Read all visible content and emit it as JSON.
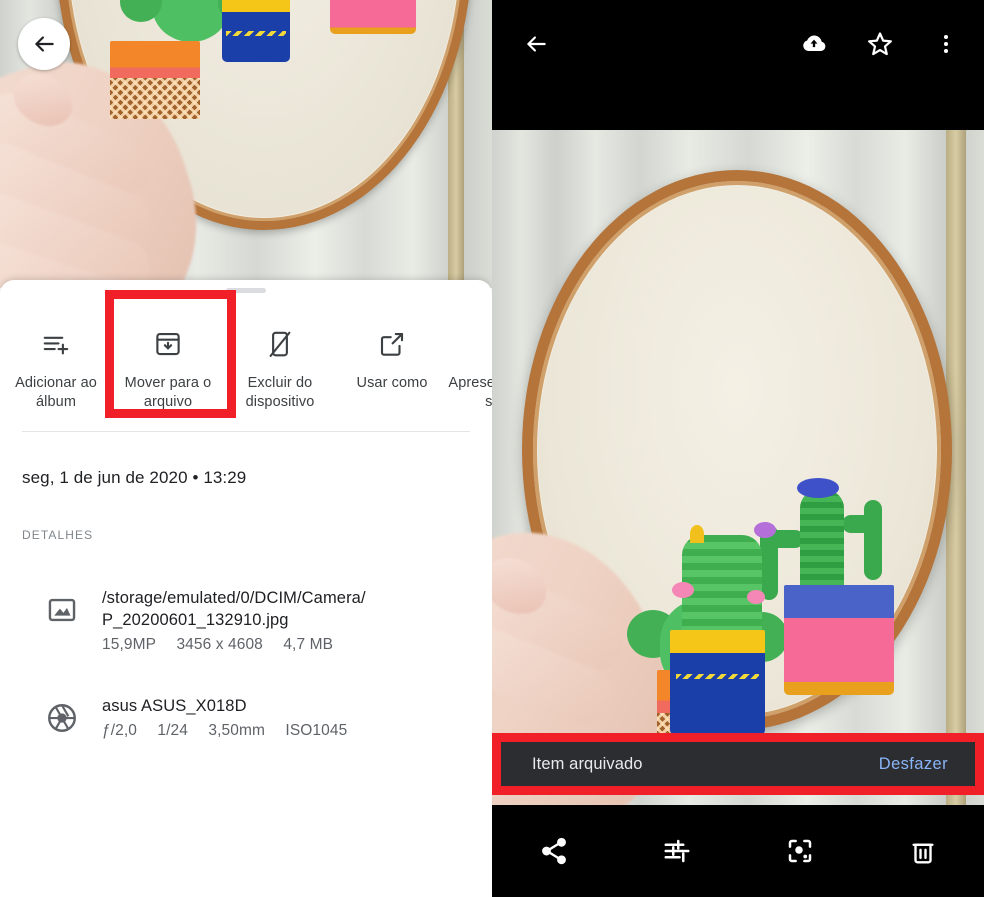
{
  "left_panel": {
    "photo": {
      "alt": "embroidery-hoop-cacti-photo-top",
      "back_icon": "back-arrow-icon"
    },
    "sheet": {
      "actions": [
        {
          "icon": "add-to-album-icon",
          "label": "Adicionar ao álbum",
          "highlighted": false
        },
        {
          "icon": "archive-icon",
          "label": "Mover para o arquivo",
          "highlighted": true
        },
        {
          "icon": "delete-from-device-icon",
          "label": "Excluir do dispositivo",
          "highlighted": false
        },
        {
          "icon": "open-external-icon",
          "label": "Usar como",
          "highlighted": false
        },
        {
          "icon": "slideshow-icon",
          "label": "Apresentação de slides",
          "highlighted": false
        }
      ],
      "datetime": "seg, 1 de jun de 2020  •  13:29",
      "details_title": "DETALHES",
      "details": [
        {
          "icon": "image-file-icon",
          "line1": "/storage/emulated/0/DCIM/Camera/",
          "line2": "P_20200601_132910.jpg",
          "meta": [
            "15,9MP",
            "3456 x 4608",
            "4,7 MB"
          ]
        },
        {
          "icon": "camera-aperture-icon",
          "line1": "asus ASUS_X018D",
          "line2": "",
          "meta": [
            "ƒ/2,0",
            "1/24",
            "3,50mm",
            "ISO1045"
          ]
        }
      ]
    }
  },
  "right_panel": {
    "topbar": {
      "back_icon": "back-arrow-icon",
      "actions": [
        {
          "icon": "cloud-upload-icon",
          "name": "backup-button"
        },
        {
          "icon": "star-outline-icon",
          "name": "favorite-button"
        },
        {
          "icon": "more-vertical-icon",
          "name": "more-options-button"
        }
      ]
    },
    "photo": {
      "alt": "embroidery-hoop-cacti-photo-full"
    },
    "snackbar": {
      "message": "Item arquivado",
      "action": "Desfazer",
      "highlighted": true
    },
    "bottombar": [
      {
        "icon": "share-icon",
        "name": "share-button"
      },
      {
        "icon": "tune-sliders-icon",
        "name": "edit-button"
      },
      {
        "icon": "lens-icon",
        "name": "lens-button"
      },
      {
        "icon": "trash-icon",
        "name": "delete-button"
      }
    ]
  },
  "colors": {
    "highlight_red": "#f01f28",
    "snackbar_bg": "#2b2d30",
    "snackbar_action": "#8ab4f8",
    "text_primary": "#202124",
    "text_secondary": "#5f6368"
  }
}
